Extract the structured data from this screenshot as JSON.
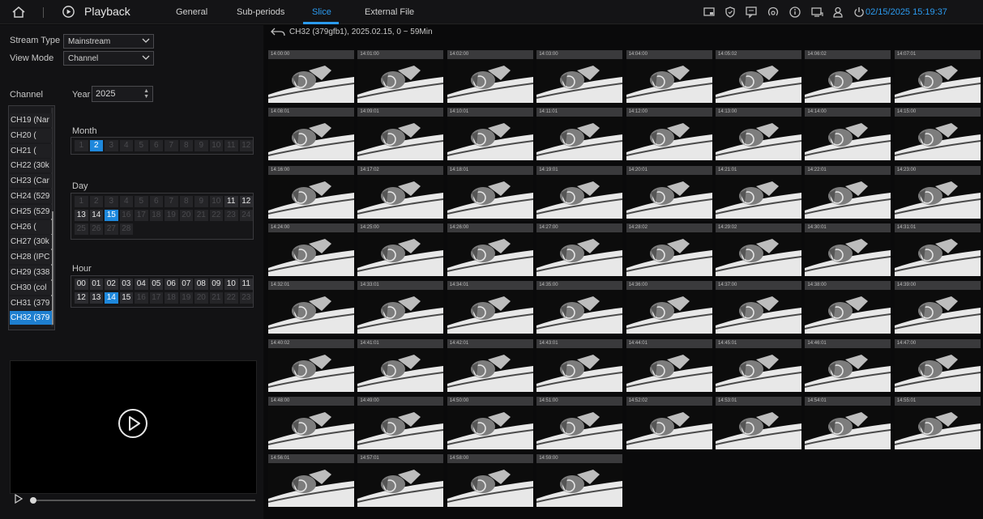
{
  "topbar": {
    "title": "Playback",
    "tabs": [
      {
        "label": "General",
        "active": false
      },
      {
        "label": "Sub-periods",
        "active": false
      },
      {
        "label": "Slice",
        "active": true
      },
      {
        "label": "External File",
        "active": false
      }
    ],
    "icons": [
      "screen-icon",
      "shield-icon",
      "monitor-chat-icon",
      "network-icon",
      "info-icon",
      "display-icon",
      "user-icon",
      "power-icon"
    ],
    "datetime": "02/15/2025 15:19:37",
    "accent_color": "#2b9bf0"
  },
  "left": {
    "stream_type": {
      "label": "Stream Type",
      "value": "Mainstream"
    },
    "view_mode": {
      "label": "View Mode",
      "value": "Channel"
    },
    "channel_label": "Channel",
    "year": {
      "label": "Year",
      "value": "2025"
    },
    "channels": [
      {
        "label": "CH19 (Nar",
        "selected": false
      },
      {
        "label": "CH20 (",
        "selected": false
      },
      {
        "label": "CH21 (",
        "selected": false
      },
      {
        "label": "CH22 (30k",
        "selected": false
      },
      {
        "label": "CH23 (Car",
        "selected": false
      },
      {
        "label": "CH24 (529",
        "selected": false
      },
      {
        "label": "CH25 (529",
        "selected": false
      },
      {
        "label": "CH26 (",
        "selected": false
      },
      {
        "label": "CH27 (30k",
        "selected": false
      },
      {
        "label": "CH28 (IPC",
        "selected": false
      },
      {
        "label": "CH29 (338",
        "selected": false
      },
      {
        "label": "CH30 (col",
        "selected": false
      },
      {
        "label": "CH31 (379",
        "selected": false
      },
      {
        "label": "CH32 (379",
        "selected": true
      }
    ],
    "month": {
      "label": "Month",
      "cells": [
        "1",
        "2",
        "3",
        "4",
        "5",
        "6",
        "7",
        "8",
        "9",
        "10",
        "11",
        "12"
      ],
      "enabled": [
        "2"
      ],
      "selected": "2"
    },
    "day": {
      "label": "Day",
      "cells": [
        "1",
        "2",
        "3",
        "4",
        "5",
        "6",
        "7",
        "8",
        "9",
        "10",
        "11",
        "12",
        "13",
        "14",
        "15",
        "16",
        "17",
        "18",
        "19",
        "20",
        "21",
        "22",
        "23",
        "24",
        "25",
        "26",
        "27",
        "28"
      ],
      "enabled": [
        "11",
        "12",
        "13",
        "14",
        "15"
      ],
      "selected": "15"
    },
    "hour": {
      "label": "Hour",
      "cells": [
        "00",
        "01",
        "02",
        "03",
        "04",
        "05",
        "06",
        "07",
        "08",
        "09",
        "10",
        "11",
        "12",
        "13",
        "14",
        "15",
        "16",
        "17",
        "18",
        "19",
        "20",
        "21",
        "22",
        "23"
      ],
      "enabled": [
        "00",
        "01",
        "02",
        "03",
        "04",
        "05",
        "06",
        "07",
        "08",
        "09",
        "10",
        "11",
        "12",
        "13",
        "14",
        "15"
      ],
      "selected": "14"
    }
  },
  "right": {
    "info": "CH32 (379gfb1),  2025.02.15,  0 ~ 59Min",
    "thumbnails": [
      "14:00:00",
      "14:01:00",
      "14:02:00",
      "14:03:00",
      "14:04:00",
      "14:05:02",
      "14:06:02",
      "14:07:01",
      "14:08:01",
      "14:09:01",
      "14:10:01",
      "14:11:01",
      "14:12:00",
      "14:13:00",
      "14:14:00",
      "14:15:00",
      "14:16:00",
      "14:17:02",
      "14:18:01",
      "14:19:01",
      "14:20:01",
      "14:21:01",
      "14:22:01",
      "14:23:00",
      "14:24:00",
      "14:25:00",
      "14:26:00",
      "14:27:00",
      "14:28:02",
      "14:29:02",
      "14:30:01",
      "14:31:01",
      "14:32:01",
      "14:33:01",
      "14:34:01",
      "14:35:00",
      "14:36:00",
      "14:37:00",
      "14:38:00",
      "14:39:00",
      "14:40:02",
      "14:41:01",
      "14:42:01",
      "14:43:01",
      "14:44:01",
      "14:45:01",
      "14:46:01",
      "14:47:00",
      "14:48:00",
      "14:49:00",
      "14:50:00",
      "14:51:00",
      "14:52:02",
      "14:53:01",
      "14:54:01",
      "14:55:01",
      "14:56:01",
      "14:57:01",
      "14:58:00",
      "14:59:00"
    ]
  }
}
